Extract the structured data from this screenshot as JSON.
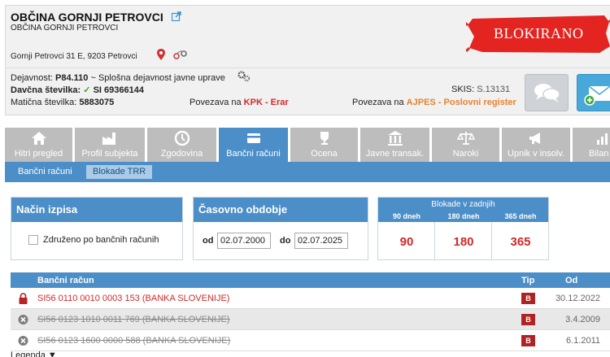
{
  "header": {
    "company_name": "OBČINA GORNJI PETROVCI",
    "company_subtitle": "OBČINA GORNJI PETROVCI",
    "address": "Gornji Petrovci 31 E, 9203 Petrovci",
    "stamp": "BLOKIRANO",
    "activity_label": "Dejavnost:",
    "activity_code": "P84.110",
    "activity_desc": "~ Splošna dejavnost javne uprave",
    "tax_label": "Davčna številka:",
    "tax_check": "✓",
    "tax_number": "SI 69366144",
    "reg_label": "Matična številka:",
    "reg_number": "5883075",
    "kpk_prefix": "Povezava na",
    "kpk_link": "KPK - Erar",
    "skis_label": "SKIS:",
    "skis_value": "S.13131",
    "ajpes_prefix": "Povezava na",
    "ajpes_link": "AJPES - Poslovni register"
  },
  "tabs": [
    {
      "label": "Hitri pregled",
      "icon": "home-icon"
    },
    {
      "label": "Profil subjekta",
      "icon": "factory-icon"
    },
    {
      "label": "Zgodovina",
      "icon": "clock-icon"
    },
    {
      "label": "Bančni računi",
      "icon": "credit-card-icon",
      "active": true
    },
    {
      "label": "Ocena",
      "icon": "trophy-icon"
    },
    {
      "label": "Javne transak.",
      "icon": "building-icon"
    },
    {
      "label": "Naroki",
      "icon": "scales-icon"
    },
    {
      "label": "Upnik v insolv.",
      "icon": "megaphone-icon"
    },
    {
      "label": "Bilan",
      "icon": "chart-icon"
    }
  ],
  "subtabs": [
    {
      "label": "Bančni računi"
    },
    {
      "label": "Blokade TRR",
      "active": true
    }
  ],
  "mode_panel": {
    "title": "Način izpisa",
    "checkbox_label": "Združeno po bančnih računih"
  },
  "period_panel": {
    "title": "Časovno obdobje",
    "from_label": "od",
    "from_value": "02.07.2000",
    "to_label": "do",
    "to_value": "02.07.2025"
  },
  "blocks_panel": {
    "title": "Blokade v zadnjih",
    "cols": [
      {
        "label": "90 dneh",
        "value": "90"
      },
      {
        "label": "180 dneh",
        "value": "180"
      },
      {
        "label": "365 dneh",
        "value": "365"
      }
    ]
  },
  "table": {
    "headers": {
      "account": "Bančni račun",
      "type": "Tip",
      "from": "Od"
    },
    "rows": [
      {
        "account": "SI56 0110 0010 0003 153 (BANKA SLOVENIJE)",
        "type": "B",
        "date": "30.12.2022",
        "status": "blocked"
      },
      {
        "account": "SI56 0123 1010 0011 769 (BANKA SLOVENIJE)",
        "type": "B",
        "date": "3.4.2009",
        "status": "closed"
      },
      {
        "account": "SI56 0123 1600 0000 588 (BANKA SLOVENIJE)",
        "type": "B",
        "date": "6.1.2011",
        "status": "closed"
      }
    ]
  },
  "legend": "Legenda ▼"
}
